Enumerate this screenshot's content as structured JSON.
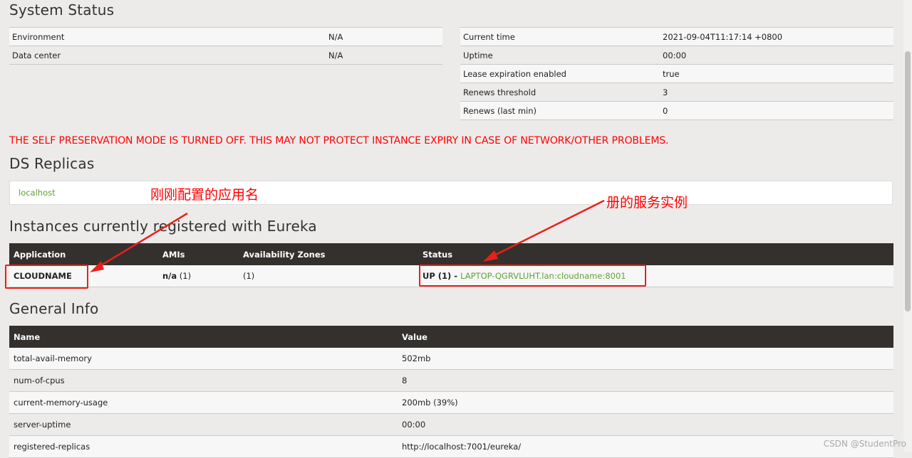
{
  "system_status": {
    "title": "System Status",
    "left": [
      {
        "k": "Environment",
        "v": "N/A"
      },
      {
        "k": "Data center",
        "v": "N/A"
      }
    ],
    "right": [
      {
        "k": "Current time",
        "v": "2021-09-04T11:17:14 +0800"
      },
      {
        "k": "Uptime",
        "v": "00:00"
      },
      {
        "k": "Lease expiration enabled",
        "v": "true"
      },
      {
        "k": "Renews threshold",
        "v": "3"
      },
      {
        "k": "Renews (last min)",
        "v": "0"
      }
    ]
  },
  "warning": "THE SELF PRESERVATION MODE IS TURNED OFF. THIS MAY NOT PROTECT INSTANCE EXPIRY IN CASE OF NETWORK/OTHER PROBLEMS.",
  "replicas": {
    "title": "DS Replicas",
    "link": "localhost"
  },
  "instances": {
    "title": "Instances currently registered with Eureka",
    "headers": [
      "Application",
      "AMIs",
      "Availability Zones",
      "Status"
    ],
    "row": {
      "application": "CLOUDNAME",
      "amis_bold": "n/a",
      "amis_count": " (1)",
      "zones": "(1)",
      "status_prefix": "UP (1) - ",
      "status_link": "LAPTOP-QGRVLUHT.lan:cloudname:8001"
    }
  },
  "general_info": {
    "title": "General Info",
    "headers": [
      "Name",
      "Value"
    ],
    "rows": [
      {
        "k": "total-avail-memory",
        "v": "502mb"
      },
      {
        "k": "num-of-cpus",
        "v": "8"
      },
      {
        "k": "current-memory-usage",
        "v": "200mb (39%)"
      },
      {
        "k": "server-uptime",
        "v": "00:00"
      },
      {
        "k": "registered-replicas",
        "v": "http://localhost:7001/eureka/"
      }
    ]
  },
  "annotations": {
    "app_name_note": "刚刚配置的应用名",
    "service_note": "册的服务实例"
  },
  "watermark": "CSDN @StudentPro",
  "colors": {
    "header_bg": "#34302d",
    "link": "#5fa134",
    "warning": "#ff0000",
    "annotation": "#ff0000"
  }
}
